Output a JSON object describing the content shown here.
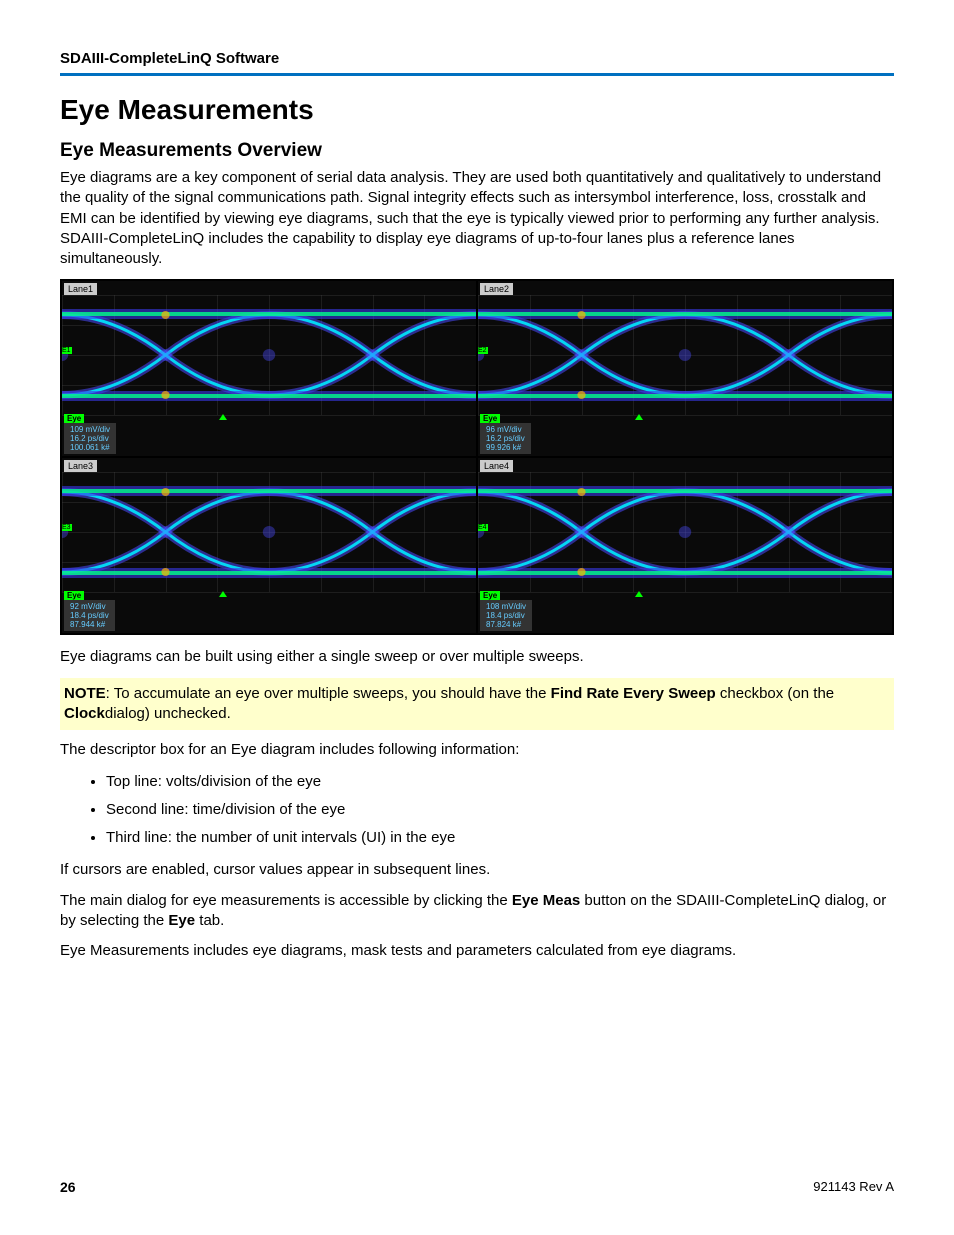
{
  "header": "SDAIII-CompleteLinQ Software",
  "h1": "Eye Measurements",
  "h2": "Eye Measurements Overview",
  "p1": "Eye diagrams are a key component of serial data analysis. They are used both quantitatively and qualitatively to understand the quality of the signal communications path. Signal integrity effects such as intersymbol interference, loss, crosstalk and EMI can be identified by viewing eye diagrams, such that the eye is typically viewed prior to performing any further analysis. SDAIII-CompleteLinQ includes the capability to display eye diagrams of up-to-four lanes plus a reference lanes simultaneously.",
  "lanes": [
    {
      "label": "Lane1",
      "tag": "Eye",
      "v": "109 mV/div",
      "t": "16.2 ps/div",
      "ui": "100.061 k#"
    },
    {
      "label": "Lane2",
      "tag": "Eye",
      "v": "96 mV/div",
      "t": "16.2 ps/div",
      "ui": "99.926 k#"
    },
    {
      "label": "Lane3",
      "tag": "Eye",
      "v": "92 mV/div",
      "t": "18.4 ps/div",
      "ui": "87.944 k#"
    },
    {
      "label": "Lane4",
      "tag": "Eye",
      "v": "108 mV/div",
      "t": "18.4 ps/div",
      "ui": "87.824 k#"
    }
  ],
  "p2": "Eye diagrams can be built using either a single sweep or over multiple sweeps.",
  "note_prefix": "NOTE",
  "note_body1": ": To accumulate an eye over multiple sweeps, you should have the ",
  "note_bold1": "Find Rate Every Sweep",
  "note_body2": " checkbox (on the ",
  "note_bold2": "Clock",
  "note_body3": "dialog) unchecked.",
  "p3": "The descriptor box for an Eye diagram includes following information:",
  "bullets": [
    "Top line: volts/division of the eye",
    "Second line: time/division of the eye",
    "Third line: the number of unit intervals (UI) in the eye"
  ],
  "p4": "If cursors are enabled, cursor values appear in subsequent lines.",
  "p5a": "The main dialog for eye measurements is accessible by clicking the ",
  "p5b": "Eye Meas",
  "p5c": " button on the SDAIII-CompleteLinQ dialog, or by selecting the ",
  "p5d": "Eye",
  "p5e": " tab.",
  "p6": "Eye Measurements includes eye diagrams, mask tests and parameters calculated from eye diagrams.",
  "page_no": "26",
  "doc_id": "921143 Rev A"
}
